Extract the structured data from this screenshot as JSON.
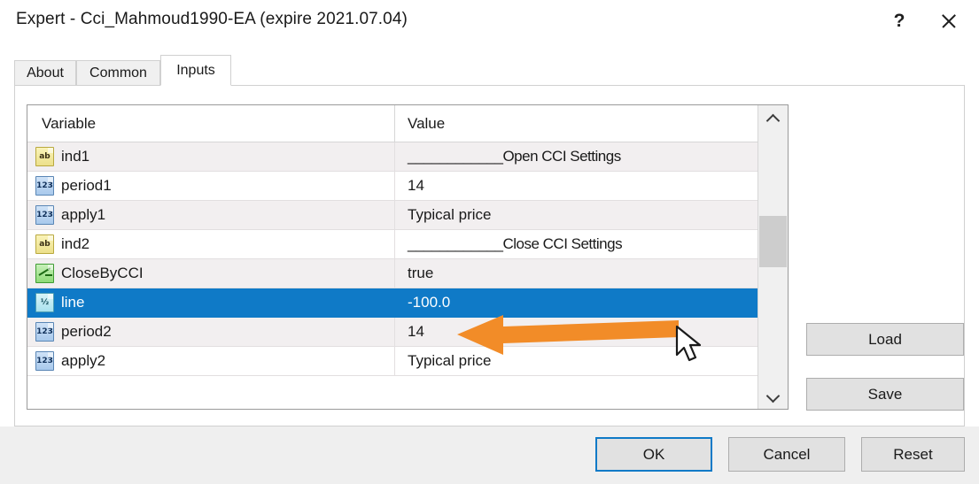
{
  "window": {
    "title": "Expert - Cci_Mahmoud1990-EA (expire 2021.07.04)",
    "help_label": "?",
    "close_label": "",
    "help_icon": "question-mark-icon",
    "close_icon": "close-icon"
  },
  "tabs": [
    {
      "label": "About",
      "active": false
    },
    {
      "label": "Common",
      "active": false
    },
    {
      "label": "Inputs",
      "active": true
    }
  ],
  "table": {
    "columns": [
      "Variable",
      "Value"
    ],
    "rows": [
      {
        "icon": "string-type-icon",
        "glyph": "ab",
        "type": "type-string",
        "variable": "ind1",
        "value": "____________Open CCI Settings",
        "selected": false
      },
      {
        "icon": "integer-type-icon",
        "glyph": "123",
        "type": "type-int",
        "variable": "period1",
        "value": "14",
        "selected": false
      },
      {
        "icon": "integer-type-icon",
        "glyph": "123",
        "type": "type-int",
        "variable": "apply1",
        "value": "Typical price",
        "selected": false
      },
      {
        "icon": "string-type-icon",
        "glyph": "ab",
        "type": "type-string",
        "variable": "ind2",
        "value": "____________Close CCI Settings",
        "selected": false
      },
      {
        "icon": "boolean-type-icon",
        "glyph": "",
        "type": "type-bool",
        "variable": "CloseByCCI",
        "value": "true",
        "selected": false
      },
      {
        "icon": "double-type-icon",
        "glyph": "½",
        "type": "type-double",
        "variable": "line",
        "value": "-100.0",
        "selected": true
      },
      {
        "icon": "integer-type-icon",
        "glyph": "123",
        "type": "type-int",
        "variable": "period2",
        "value": "14",
        "selected": false
      },
      {
        "icon": "integer-type-icon",
        "glyph": "123",
        "type": "type-int",
        "variable": "apply2",
        "value": "Typical price",
        "selected": false
      }
    ],
    "scrollbar": {
      "up_icon": "chevron-up-icon",
      "down_icon": "chevron-down-icon"
    }
  },
  "side_buttons": {
    "load_label": "Load",
    "save_label": "Save"
  },
  "footer_buttons": {
    "ok_label": "OK",
    "cancel_label": "Cancel",
    "reset_label": "Reset"
  },
  "annotation": {
    "arrow_icon": "left-arrow-annotation",
    "arrow_color": "#F28C28",
    "cursor_icon": "mouse-pointer-cursor"
  },
  "colors": {
    "selection": "#0F7AC7",
    "row_alt": "#F2EFF0",
    "dialog_bg": "#FFFFFF",
    "footer_bg": "#EFEFEF"
  }
}
